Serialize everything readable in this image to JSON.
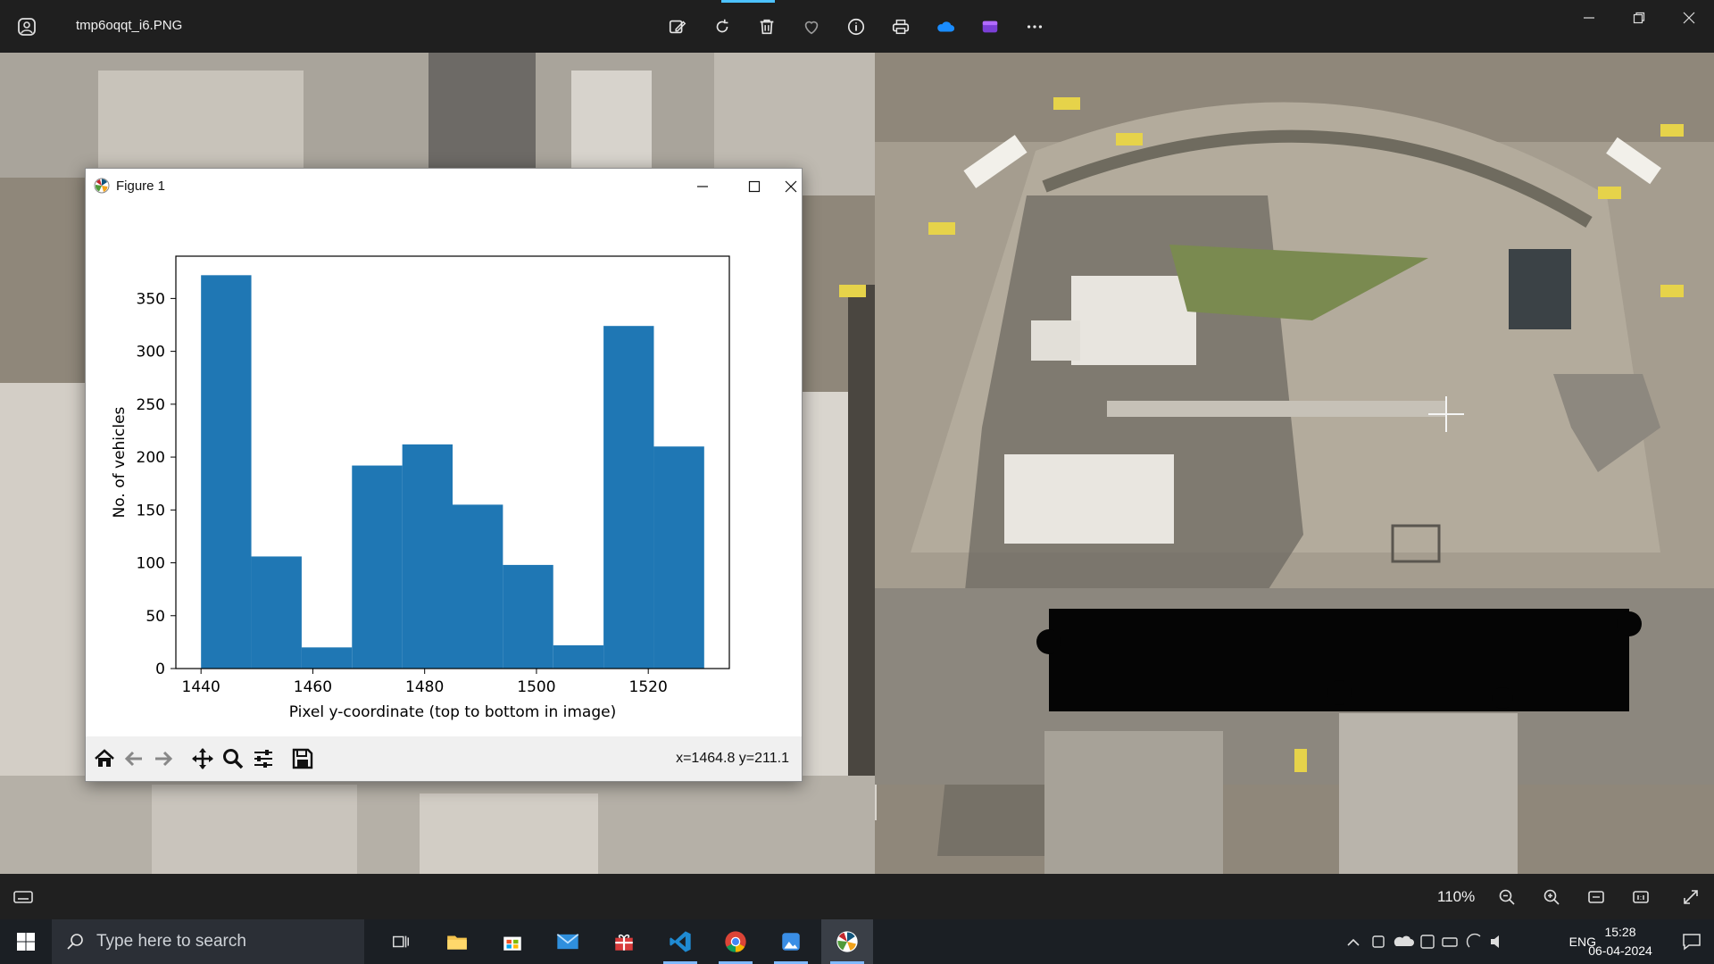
{
  "window": {
    "filename": "tmp6oqqt_i6.PNG",
    "toolbar_icons": [
      "edit-image-icon",
      "rotate-icon",
      "delete-icon",
      "favorite-icon",
      "info-icon",
      "print-icon",
      "onedrive-icon",
      "clipchamp-icon",
      "more-icon"
    ],
    "controls": [
      "minimize-icon",
      "restore-icon",
      "close-icon"
    ]
  },
  "photo_bar": {
    "zoom": "110%",
    "buttons": [
      "zoom-out-icon",
      "zoom-in-icon",
      "fit-window-icon",
      "actual-size-icon",
      "fullscreen-icon"
    ]
  },
  "figure": {
    "title": "Figure 1",
    "coord_readout": "x=1464.8 y=211.1",
    "toolbar": [
      "home-icon",
      "back-icon",
      "forward-icon",
      "pan-icon",
      "zoom-icon",
      "configure-icon",
      "save-icon"
    ]
  },
  "chart_data": {
    "type": "bar",
    "title": "",
    "xlabel": "Pixel y-coordinate (top to bottom in image)",
    "ylabel": "No. of vehicles",
    "bin_edges": [
      1440,
      1449,
      1458,
      1467,
      1476,
      1485,
      1494,
      1503,
      1512,
      1521,
      1530
    ],
    "values": [
      372,
      106,
      20,
      192,
      212,
      155,
      98,
      22,
      324,
      210
    ],
    "xlim": [
      1435.5,
      1534.5
    ],
    "ylim": [
      0,
      390
    ],
    "xticks": [
      "1440",
      "1460",
      "1480",
      "1500",
      "1520"
    ],
    "xtick_values": [
      1440,
      1460,
      1480,
      1500,
      1520
    ],
    "yticks": [
      "0",
      "50",
      "100",
      "150",
      "200",
      "250",
      "300",
      "350"
    ],
    "ytick_values": [
      0,
      50,
      100,
      150,
      200,
      250,
      300,
      350
    ],
    "bar_color": "#1f77b4",
    "grid": false
  },
  "taskbar": {
    "search_placeholder": "Type here to search",
    "language": "ENG",
    "time": "15:28",
    "date": "06-04-2024",
    "apps": [
      "task-view-icon",
      "file-explorer-icon",
      "microsoft-store-icon",
      "mail-icon",
      "gift-app-icon",
      "vscode-icon",
      "chrome-icon",
      "photos-icon",
      "matplotlib-icon"
    ]
  },
  "colors": {
    "accent": "#4cc2ff",
    "titlebar": "#1f1f1f",
    "taskbar": "#1b1f24"
  }
}
